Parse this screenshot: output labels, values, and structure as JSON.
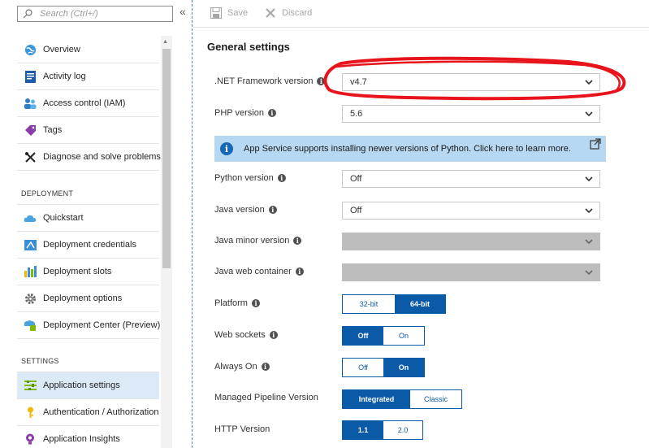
{
  "search": {
    "placeholder": "Search (Ctrl+/)"
  },
  "sidebar": {
    "items_top": [
      {
        "label": "Overview",
        "icon": "globe-icon"
      },
      {
        "label": "Activity log",
        "icon": "log-icon"
      },
      {
        "label": "Access control (IAM)",
        "icon": "people-icon"
      },
      {
        "label": "Tags",
        "icon": "tag-icon"
      },
      {
        "label": "Diagnose and solve problems",
        "icon": "wrench-icon"
      }
    ],
    "deployment_heading": "DEPLOYMENT",
    "items_deployment": [
      {
        "label": "Quickstart",
        "icon": "cloud-icon"
      },
      {
        "label": "Deployment credentials",
        "icon": "credentials-icon"
      },
      {
        "label": "Deployment slots",
        "icon": "slots-icon"
      },
      {
        "label": "Deployment options",
        "icon": "gear-icon"
      },
      {
        "label": "Deployment Center (Preview)",
        "icon": "deploy-center-icon"
      }
    ],
    "settings_heading": "SETTINGS",
    "items_settings": [
      {
        "label": "Application settings",
        "icon": "settings-list-icon",
        "active": true
      },
      {
        "label": "Authentication / Authorization",
        "icon": "key-icon"
      },
      {
        "label": "Application Insights",
        "icon": "lightbulb-icon"
      }
    ]
  },
  "toolbar": {
    "save_label": "Save",
    "discard_label": "Discard"
  },
  "main": {
    "section_title": "General settings",
    "net_framework": {
      "label": ".NET Framework version",
      "value": "v4.7"
    },
    "php": {
      "label": "PHP version",
      "value": "5.6"
    },
    "banner": {
      "text": "App Service supports installing newer versions of Python. Click here to learn more."
    },
    "python": {
      "label": "Python version",
      "value": "Off"
    },
    "java": {
      "label": "Java version",
      "value": "Off"
    },
    "java_minor": {
      "label": "Java minor version",
      "value": ""
    },
    "java_container": {
      "label": "Java web container",
      "value": ""
    },
    "platform": {
      "label": "Platform",
      "options": [
        "32-bit",
        "64-bit"
      ],
      "selected": "64-bit"
    },
    "web_sockets": {
      "label": "Web sockets",
      "options": [
        "Off",
        "On"
      ],
      "selected": "Off"
    },
    "always_on": {
      "label": "Always On",
      "options": [
        "Off",
        "On"
      ],
      "selected": "On"
    },
    "pipeline": {
      "label": "Managed Pipeline Version",
      "options": [
        "Integrated",
        "Classic"
      ],
      "selected": "Integrated"
    },
    "http": {
      "label": "HTTP Version",
      "options": [
        "1.1",
        "2.0"
      ],
      "selected": "1.1"
    }
  },
  "colors": {
    "accent": "#0a5aa8",
    "banner": "#b6d8f2",
    "annotation": "#e8141c",
    "active_nav": "#dce9f6"
  }
}
